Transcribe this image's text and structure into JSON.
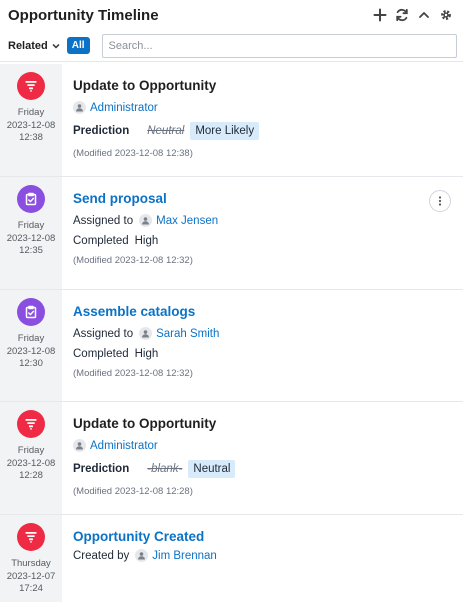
{
  "header": {
    "title": "Opportunity Timeline",
    "icons": [
      "plus-icon",
      "refresh-icon",
      "collapse-icon",
      "gear-icon"
    ]
  },
  "filter": {
    "related_label": "Related",
    "all_label": "All",
    "search_placeholder": "Search...",
    "search_value": ""
  },
  "colors": {
    "accent": "#0b72c5",
    "badge_red": "#ee2a45",
    "badge_purple": "#8a4fe0",
    "pill_bg": "#d7ebfb",
    "left_bg": "#f1f3f5"
  },
  "entries": [
    {
      "day": "Friday",
      "date": "2023-12-08",
      "time": "12:38",
      "title": "Update to Opportunity",
      "user": "Administrator",
      "field_label": "Prediction",
      "old_value": "Neutral",
      "new_value": "More Likely",
      "modified": "(Modified 2023-12-08 12:38)"
    },
    {
      "day": "Friday",
      "date": "2023-12-08",
      "time": "12:35",
      "title": "Send proposal",
      "assigned_label": "Assigned to",
      "user": "Max Jensen",
      "status": "Completed",
      "priority": "High",
      "modified": "(Modified 2023-12-08 12:32)"
    },
    {
      "day": "Friday",
      "date": "2023-12-08",
      "time": "12:30",
      "title": "Assemble catalogs",
      "assigned_label": "Assigned to",
      "user": "Sarah Smith",
      "status": "Completed",
      "priority": "High",
      "modified": "(Modified 2023-12-08 12:32)"
    },
    {
      "day": "Friday",
      "date": "2023-12-08",
      "time": "12:28",
      "title": "Update to Opportunity",
      "user": "Administrator",
      "field_label": "Prediction",
      "old_value": "-blank-",
      "new_value": "Neutral",
      "modified": "(Modified 2023-12-08 12:28)"
    },
    {
      "day": "Thursday",
      "date": "2023-12-07",
      "time": "17:24",
      "title": "Opportunity Created",
      "created_label": "Created by",
      "user": "Jim Brennan"
    }
  ]
}
